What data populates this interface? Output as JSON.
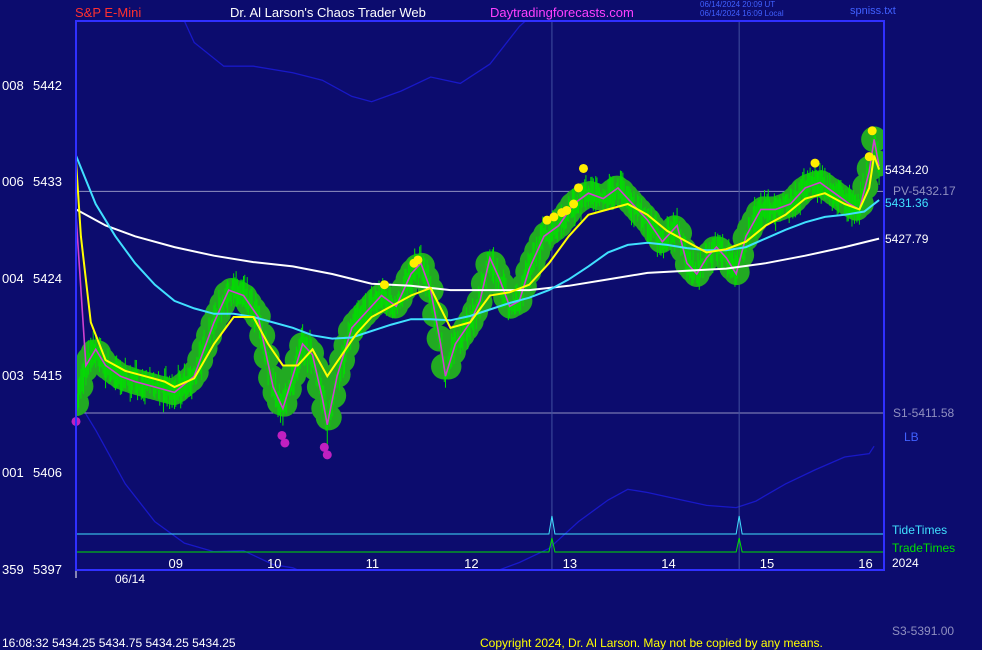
{
  "header": {
    "instrument": "S&P E-Mini",
    "site": "Dr. Al Larson's Chaos Trader Web",
    "url": "Daytradingforecasts.com",
    "time_utc": "06/14/2024 20:09 UT",
    "time_local": "06/14/2024 16:09 Local",
    "file": "spniss.txt"
  },
  "footer": {
    "quote": "16:08:32  5434.25 5434.75 5434.25 5434.25",
    "copyright": "Copyright 2024, Dr. Al Larson. May not be copied by any means."
  },
  "colors": {
    "background": "#0c0c6e",
    "plot_border": "#3030ff",
    "price_bars": "#00e000",
    "price_halo": "#22aa22",
    "fast_ma": "#ffff00",
    "mid_ma": "#40e0ff",
    "slow_ma": "#ffffff",
    "cycle_line": "#d040d0",
    "envelope": "#1818c8",
    "highs": "#ffee00",
    "lows": "#c020c0"
  },
  "chart_data": {
    "type": "line",
    "x_axis": {
      "range": [
        8.0,
        16.2
      ],
      "ticks": [
        {
          "x": 9,
          "label": "09"
        },
        {
          "x": 10,
          "label": "10"
        },
        {
          "x": 11,
          "label": "11"
        },
        {
          "x": 12,
          "label": "12"
        },
        {
          "x": 13,
          "label": "13"
        },
        {
          "x": 14,
          "label": "14"
        },
        {
          "x": 15,
          "label": "15"
        },
        {
          "x": 16,
          "label": "16"
        }
      ],
      "date_label": "06/14",
      "year_label": "2024",
      "session_start": 8.0
    },
    "y_axis": {
      "range": [
        5397,
        5448
      ],
      "ticks": [
        {
          "y": 5442,
          "code": "008",
          "label": "5442"
        },
        {
          "y": 5433,
          "code": "006",
          "label": "5433"
        },
        {
          "y": 5424,
          "code": "004",
          "label": "5424"
        },
        {
          "y": 5415,
          "code": "003",
          "label": "5415"
        },
        {
          "y": 5406,
          "code": "001",
          "label": "5406"
        },
        {
          "y": 5397,
          "code": "359",
          "label": "5397"
        }
      ]
    },
    "levels": [
      {
        "y": 5432.17,
        "label": "PV-5432.17"
      },
      {
        "y": 5411.58,
        "label": "S1-5411.58"
      }
    ],
    "off_scale_labels": [
      {
        "label": "S3-5391.00"
      },
      {
        "label": "LB"
      }
    ],
    "last_values": [
      {
        "series": "fast",
        "y": 5434.2,
        "label": "5434.20"
      },
      {
        "series": "mid",
        "y": 5431.36,
        "label": "5431.36"
      },
      {
        "series": "slow",
        "y": 5427.79,
        "label": "5427.79"
      }
    ],
    "vertical_markers": [
      12.83,
      14.73
    ],
    "timing_lines": [
      {
        "name": "TideTimes"
      },
      {
        "name": "TradeTimes"
      }
    ],
    "price": [
      [
        8.0,
        5412.5
      ],
      [
        8.1,
        5416
      ],
      [
        8.2,
        5417.5
      ],
      [
        8.3,
        5416
      ],
      [
        8.45,
        5415
      ],
      [
        8.6,
        5414.5
      ],
      [
        8.8,
        5414
      ],
      [
        9.0,
        5413.5
      ],
      [
        9.2,
        5415
      ],
      [
        9.4,
        5420
      ],
      [
        9.55,
        5423
      ],
      [
        9.7,
        5422.5
      ],
      [
        9.85,
        5420.5
      ],
      [
        10.0,
        5414
      ],
      [
        10.1,
        5412
      ],
      [
        10.2,
        5415
      ],
      [
        10.3,
        5418
      ],
      [
        10.4,
        5417
      ],
      [
        10.5,
        5413
      ],
      [
        10.55,
        5410.5
      ],
      [
        10.65,
        5415
      ],
      [
        10.8,
        5419.5
      ],
      [
        10.95,
        5421
      ],
      [
        11.1,
        5422.5
      ],
      [
        11.25,
        5421.5
      ],
      [
        11.4,
        5424.5
      ],
      [
        11.5,
        5425.5
      ],
      [
        11.6,
        5423
      ],
      [
        11.7,
        5418
      ],
      [
        11.75,
        5415
      ],
      [
        11.85,
        5418
      ],
      [
        12.0,
        5420
      ],
      [
        12.1,
        5422
      ],
      [
        12.2,
        5426
      ],
      [
        12.3,
        5424
      ],
      [
        12.4,
        5421.5
      ],
      [
        12.5,
        5422
      ],
      [
        12.6,
        5425
      ],
      [
        12.75,
        5428
      ],
      [
        12.9,
        5429
      ],
      [
        13.05,
        5431
      ],
      [
        13.2,
        5432
      ],
      [
        13.35,
        5431.5
      ],
      [
        13.5,
        5432.5
      ],
      [
        13.65,
        5431
      ],
      [
        13.8,
        5429.5
      ],
      [
        13.95,
        5427.5
      ],
      [
        14.1,
        5429
      ],
      [
        14.2,
        5425.5
      ],
      [
        14.3,
        5424.5
      ],
      [
        14.4,
        5426
      ],
      [
        14.5,
        5427
      ],
      [
        14.6,
        5426
      ],
      [
        14.7,
        5424.5
      ],
      [
        14.8,
        5428
      ],
      [
        14.95,
        5430.5
      ],
      [
        15.1,
        5430.5
      ],
      [
        15.25,
        5431
      ],
      [
        15.4,
        5432.5
      ],
      [
        15.55,
        5433
      ],
      [
        15.7,
        5432
      ],
      [
        15.85,
        5431
      ],
      [
        15.95,
        5430.5
      ],
      [
        16.05,
        5434
      ],
      [
        16.1,
        5437
      ],
      [
        16.15,
        5434.5
      ]
    ],
    "fast": [
      [
        8.0,
        5435
      ],
      [
        8.05,
        5428
      ],
      [
        8.15,
        5420
      ],
      [
        8.3,
        5416.5
      ],
      [
        8.5,
        5415.5
      ],
      [
        8.7,
        5415
      ],
      [
        8.9,
        5414.5
      ],
      [
        9.0,
        5414
      ],
      [
        9.2,
        5414.8
      ],
      [
        9.4,
        5418
      ],
      [
        9.6,
        5420.5
      ],
      [
        9.8,
        5420.5
      ],
      [
        9.95,
        5418
      ],
      [
        10.1,
        5416
      ],
      [
        10.25,
        5416
      ],
      [
        10.4,
        5417.5
      ],
      [
        10.55,
        5415
      ],
      [
        10.7,
        5417
      ],
      [
        10.85,
        5419
      ],
      [
        11.0,
        5420.5
      ],
      [
        11.2,
        5421.5
      ],
      [
        11.4,
        5422.5
      ],
      [
        11.6,
        5423.2
      ],
      [
        11.8,
        5419.5
      ],
      [
        12.0,
        5420
      ],
      [
        12.2,
        5422.5
      ],
      [
        12.4,
        5422.8
      ],
      [
        12.6,
        5423.5
      ],
      [
        12.8,
        5425.5
      ],
      [
        13.0,
        5428
      ],
      [
        13.2,
        5430
      ],
      [
        13.4,
        5430.5
      ],
      [
        13.6,
        5431
      ],
      [
        13.8,
        5430
      ],
      [
        14.0,
        5428.5
      ],
      [
        14.2,
        5427.5
      ],
      [
        14.4,
        5426.5
      ],
      [
        14.6,
        5426.8
      ],
      [
        14.8,
        5427.5
      ],
      [
        15.0,
        5429
      ],
      [
        15.2,
        5430
      ],
      [
        15.4,
        5431.5
      ],
      [
        15.6,
        5432
      ],
      [
        15.8,
        5431
      ],
      [
        15.95,
        5430.5
      ],
      [
        16.05,
        5432.5
      ],
      [
        16.1,
        5435.5
      ],
      [
        16.15,
        5434.2
      ]
    ],
    "mid": [
      [
        8.0,
        5435.5
      ],
      [
        8.2,
        5431
      ],
      [
        8.4,
        5428
      ],
      [
        8.6,
        5425.5
      ],
      [
        8.8,
        5423.5
      ],
      [
        9.0,
        5422
      ],
      [
        9.2,
        5421.3
      ],
      [
        9.4,
        5420.8
      ],
      [
        9.6,
        5420.8
      ],
      [
        9.8,
        5420.5
      ],
      [
        10.0,
        5420
      ],
      [
        10.2,
        5419.5
      ],
      [
        10.4,
        5418.8
      ],
      [
        10.6,
        5418.5
      ],
      [
        10.8,
        5418.6
      ],
      [
        11.0,
        5419.2
      ],
      [
        11.2,
        5419.8
      ],
      [
        11.4,
        5420.3
      ],
      [
        11.6,
        5420.3
      ],
      [
        11.8,
        5420.2
      ],
      [
        12.0,
        5420.6
      ],
      [
        12.2,
        5421.2
      ],
      [
        12.4,
        5421.8
      ],
      [
        12.6,
        5422.3
      ],
      [
        12.8,
        5423
      ],
      [
        13.0,
        5424
      ],
      [
        13.2,
        5425.2
      ],
      [
        13.4,
        5426.5
      ],
      [
        13.6,
        5427.2
      ],
      [
        13.8,
        5427.4
      ],
      [
        14.0,
        5427.2
      ],
      [
        14.2,
        5426.9
      ],
      [
        14.4,
        5426.7
      ],
      [
        14.6,
        5426.7
      ],
      [
        14.8,
        5427
      ],
      [
        15.0,
        5427.8
      ],
      [
        15.2,
        5428.6
      ],
      [
        15.4,
        5429.3
      ],
      [
        15.6,
        5429.8
      ],
      [
        15.8,
        5430
      ],
      [
        16.0,
        5430.3
      ],
      [
        16.15,
        5431.36
      ]
    ],
    "slow": [
      [
        8.0,
        5430.5
      ],
      [
        8.3,
        5429
      ],
      [
        8.6,
        5428
      ],
      [
        9.0,
        5427
      ],
      [
        9.4,
        5426.2
      ],
      [
        9.8,
        5425.6
      ],
      [
        10.2,
        5425.2
      ],
      [
        10.6,
        5424.5
      ],
      [
        11.0,
        5423.6
      ],
      [
        11.4,
        5423.4
      ],
      [
        11.8,
        5423
      ],
      [
        12.2,
        5423
      ],
      [
        12.6,
        5423
      ],
      [
        13.0,
        5423.4
      ],
      [
        13.4,
        5424
      ],
      [
        13.8,
        5424.6
      ],
      [
        14.2,
        5424.8
      ],
      [
        14.6,
        5425
      ],
      [
        15.0,
        5425.5
      ],
      [
        15.4,
        5426.2
      ],
      [
        15.8,
        5427
      ],
      [
        16.15,
        5427.79
      ]
    ],
    "upper_envelope": [
      [
        8.0,
        5460
      ],
      [
        8.5,
        5459
      ],
      [
        8.9,
        5452
      ],
      [
        9.2,
        5446
      ],
      [
        9.5,
        5443.8
      ],
      [
        9.8,
        5443.8
      ],
      [
        10.2,
        5443.2
      ],
      [
        10.5,
        5442.5
      ],
      [
        10.8,
        5441
      ],
      [
        11.0,
        5440.5
      ],
      [
        11.3,
        5441.5
      ],
      [
        11.6,
        5442.8
      ],
      [
        11.9,
        5442.2
      ],
      [
        12.2,
        5444
      ],
      [
        12.5,
        5447.5
      ],
      [
        12.8,
        5450
      ]
    ],
    "lower_envelope": [
      [
        8.0,
        5413
      ],
      [
        8.2,
        5410
      ],
      [
        8.5,
        5405
      ],
      [
        8.8,
        5401.5
      ],
      [
        9.1,
        5399.5
      ],
      [
        9.4,
        5398.7
      ],
      [
        9.7,
        5398.8
      ],
      [
        10.0,
        5397.5
      ],
      [
        10.2,
        5397.2
      ],
      [
        10.5,
        5396
      ],
      [
        11.0,
        5394.5
      ],
      [
        11.5,
        5395
      ],
      [
        12.0,
        5396
      ],
      [
        12.5,
        5397.7
      ],
      [
        12.8,
        5399
      ],
      [
        13.1,
        5401.5
      ],
      [
        13.4,
        5403.5
      ],
      [
        13.6,
        5404.5
      ],
      [
        13.8,
        5404.2
      ],
      [
        14.1,
        5403.6
      ],
      [
        14.4,
        5403
      ],
      [
        14.7,
        5402.8
      ],
      [
        14.9,
        5403.4
      ],
      [
        15.2,
        5405
      ],
      [
        15.5,
        5406.3
      ],
      [
        15.8,
        5407.5
      ],
      [
        16.05,
        5407.8
      ],
      [
        16.1,
        5408.5
      ]
    ],
    "swing_highs": [
      [
        11.13,
        5423.5
      ],
      [
        11.43,
        5425.5
      ],
      [
        11.47,
        5425.8
      ],
      [
        12.78,
        5429.5
      ],
      [
        12.85,
        5429.8
      ],
      [
        12.93,
        5430.2
      ],
      [
        12.98,
        5430.4
      ],
      [
        13.05,
        5431
      ],
      [
        13.1,
        5432.5
      ],
      [
        13.15,
        5434.3
      ],
      [
        15.5,
        5434.8
      ],
      [
        16.05,
        5435.4
      ],
      [
        16.08,
        5437.8
      ]
    ],
    "swing_lows": [
      [
        8.0,
        5410.8
      ],
      [
        10.09,
        5409.5
      ],
      [
        10.12,
        5408.8
      ],
      [
        10.52,
        5408.4
      ],
      [
        10.55,
        5407.7
      ]
    ]
  }
}
